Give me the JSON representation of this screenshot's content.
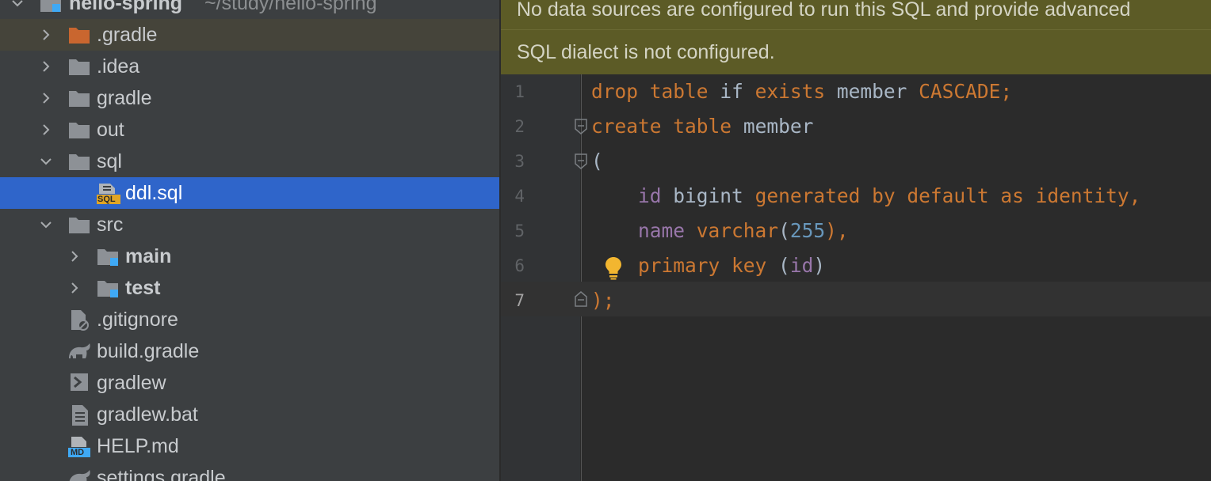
{
  "project_tree": {
    "root": {
      "label": "hello-spring",
      "path": "~/study/hello-spring"
    },
    "items": [
      {
        "label": ".gradle",
        "icon": "folder-excluded-icon"
      },
      {
        "label": ".idea",
        "icon": "folder-icon"
      },
      {
        "label": "gradle",
        "icon": "folder-icon"
      },
      {
        "label": "out",
        "icon": "folder-icon"
      },
      {
        "label": "sql",
        "icon": "folder-icon"
      },
      {
        "label": "ddl.sql",
        "icon": "sql-file-icon"
      },
      {
        "label": "src",
        "icon": "folder-icon"
      },
      {
        "label": "main",
        "icon": "source-folder-icon"
      },
      {
        "label": "test",
        "icon": "test-folder-icon"
      },
      {
        "label": ".gitignore",
        "icon": "gitignore-file-icon"
      },
      {
        "label": "build.gradle",
        "icon": "gradle-file-icon"
      },
      {
        "label": "gradlew",
        "icon": "shell-script-icon"
      },
      {
        "label": "gradlew.bat",
        "icon": "text-file-icon"
      },
      {
        "label": "HELP.md",
        "icon": "markdown-file-icon"
      },
      {
        "label": "settings.gradle",
        "icon": "gradle-file-icon"
      }
    ],
    "md_badge": "MD",
    "sql_badge": "SQL"
  },
  "editor": {
    "banner_datasource": "No data sources are configured to run this SQL and provide advanced",
    "banner_dialect": "SQL dialect is not configured.",
    "line_numbers": [
      "1",
      "2",
      "3",
      "4",
      "5",
      "6",
      "7"
    ],
    "lines": [
      [
        "drop",
        "table",
        "if",
        "exists",
        "member",
        "CASCADE;"
      ],
      [
        "create",
        "table",
        "member"
      ],
      [
        "("
      ],
      [
        "id",
        "bigint",
        "generated by default as identity,"
      ],
      [
        "name",
        "varchar",
        "(",
        "255",
        "),"
      ],
      [
        "primary key",
        "(",
        "id",
        ")"
      ],
      [
        ");"
      ]
    ]
  },
  "colors": {
    "keyword": "#cc7832",
    "identifier": "#9876aa",
    "number": "#6897bb",
    "text": "#a9b7c6",
    "selection": "#2f65ca",
    "banner": "#5c5b26"
  }
}
